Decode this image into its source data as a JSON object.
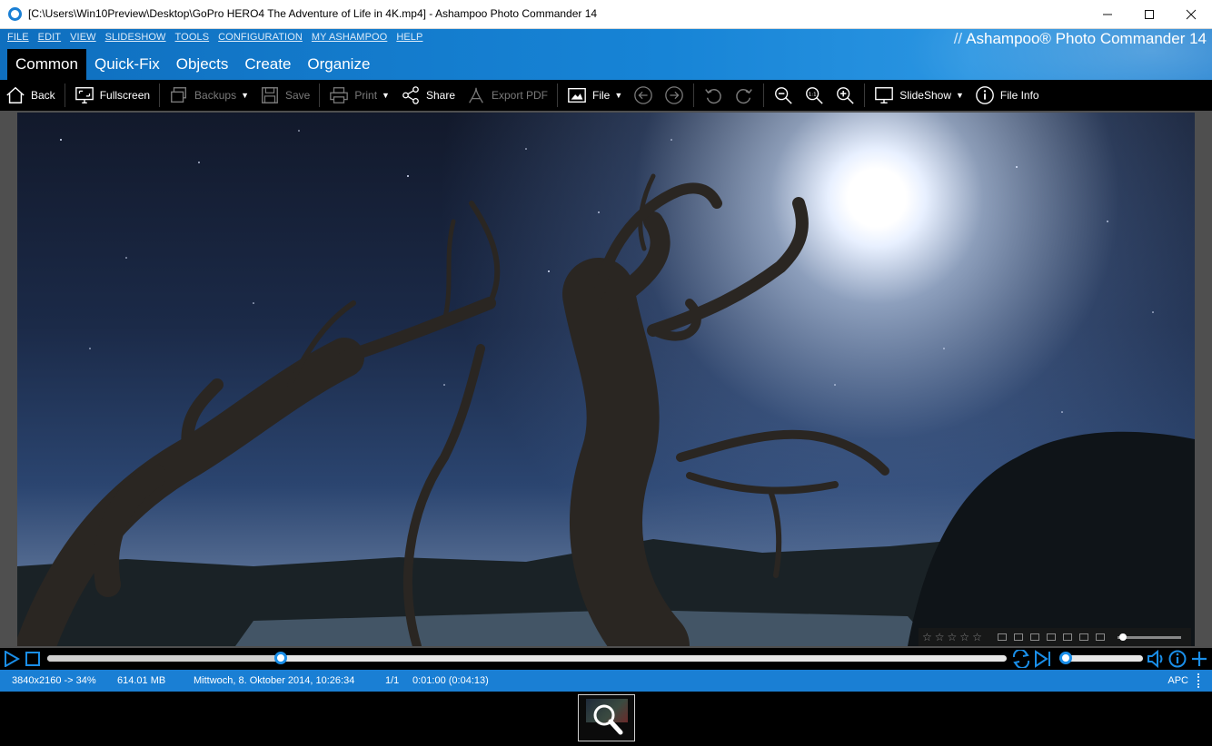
{
  "window": {
    "title": "[C:\\Users\\Win10Preview\\Desktop\\GoPro HERO4  The Adventure of Life in 4K.mp4] - Ashampoo Photo Commander 14",
    "minimize": "—",
    "maximize": "☐",
    "close": "✕"
  },
  "menu": {
    "items": [
      "FILE",
      "EDIT",
      "VIEW",
      "SLIDESHOW",
      "TOOLS",
      "CONFIGURATION",
      "MY ASHAMPOO",
      "HELP"
    ]
  },
  "brand": {
    "slashes": "//",
    "name": "Ashampoo® Photo Commander 14"
  },
  "tabs": [
    {
      "label": "Common",
      "active": true
    },
    {
      "label": "Quick-Fix",
      "active": false
    },
    {
      "label": "Objects",
      "active": false
    },
    {
      "label": "Create",
      "active": false
    },
    {
      "label": "Organize",
      "active": false
    }
  ],
  "toolbar": {
    "back": "Back",
    "fullscreen": "Fullscreen",
    "backups": "Backups",
    "save": "Save",
    "print": "Print",
    "share": "Share",
    "export_pdf": "Export PDF",
    "file": "File",
    "slideshow": "SlideShow",
    "file_info": "File Info",
    "zoom_actual": "1:1"
  },
  "playback": {
    "position_fraction": 0.243,
    "volume_fraction": 0.0
  },
  "status": {
    "resolution": "3840x2160 -> 34%",
    "size": "614.01 MB",
    "date": "Mittwoch, 8. Oktober 2014, 10:26:34",
    "index": "1/1",
    "time": "0:01:00 (0:04:13)",
    "apc": "APC"
  },
  "colors": {
    "accent": "#1a7fd4",
    "toolbar_bg": "#000000",
    "disabled_text": "#7a7a7a"
  }
}
